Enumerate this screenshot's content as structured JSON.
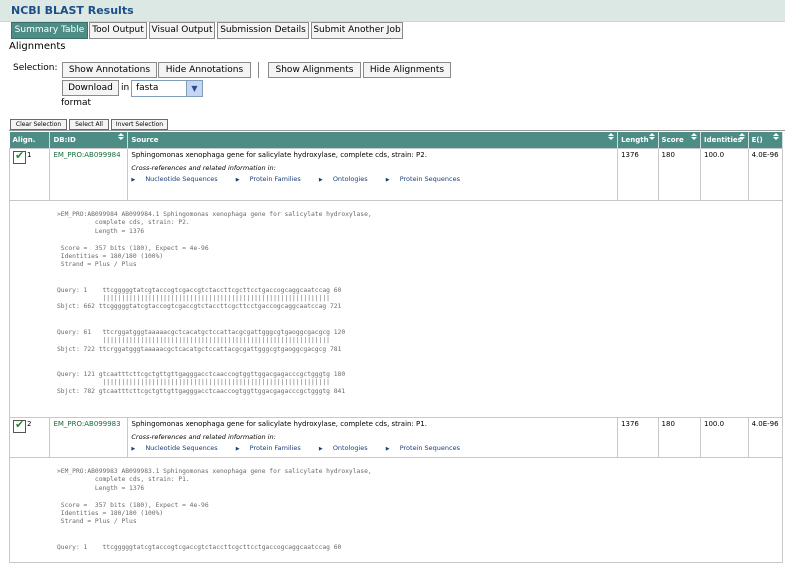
{
  "title": "NCBI BLAST Results",
  "tabs": [
    {
      "label": "Summary Table",
      "active": true
    },
    {
      "label": "Tool Output",
      "active": false
    },
    {
      "label": "Visual Output",
      "active": false
    },
    {
      "label": "Submission Details",
      "active": false
    },
    {
      "label": "Submit Another Job",
      "active": false
    }
  ],
  "section_heading": "Alignments",
  "selection": {
    "label": "Selection:",
    "show_annotations": "Show Annotations",
    "hide_annotations": "Hide Annotations",
    "show_alignments": "Show Alignments",
    "hide_alignments": "Hide Alignments",
    "download": "Download",
    "in_label": "in",
    "format_value": "fasta",
    "format_label": "format"
  },
  "small_buttons": {
    "clear": "Clear Selection",
    "select_all": "Select All",
    "invert": "Invert Selection"
  },
  "columns": [
    "Align.",
    "DB:ID",
    "Source",
    "Length",
    "Score",
    "Identities",
    "E()"
  ],
  "xref_label": "Cross-references and related information in:",
  "xref_links": [
    "Nucleotide Sequences",
    "Protein Families",
    "Ontologies",
    "Protein Sequences"
  ],
  "rows": [
    {
      "num": "1",
      "id": "EM_PRO:AB099984",
      "source": "Sphingomonas xenophaga gene for salicylate hydroxylase, complete cds, strain: P2.",
      "length": "1376",
      "score": "180",
      "identities": "100.0",
      "evalue": "4.0E-96",
      "alignment": ">EM_PRO:AB099984 AB099984.1 Sphingomonas xenophaga gene for salicylate hydroxylase,\n          complete cds, strain: P2.\n          Length = 1376\n\n Score =  357 bits (180), Expect = 4e-96\n Identities = 180/180 (100%)\n Strand = Plus / Plus\n\n\nQuery: 1    ttcgggggtatcgtaccogtcgaccgtctaccttcgcttcctgaccogcaggcaatccag 60\n            ||||||||||||||||||||||||||||||||||||||||||||||||||||||||||||\nSbjct: 662 ttcgggggtatcgtaccogtcgaccgtctaccttcgcttcctgaccogcaggcaatccag 721\n\n\nQuery: 61   ttcrggatgggtaaaaacgctcacatgctccattacgcgattgggcgtgaoggcgacgcg 120\n            ||||||||||||||||||||||||||||||||||||||||||||||||||||||||||||\nSbjct: 722 ttcrggatgggtaaaaacgctcacatgctccattacgcgattgggcgtgaoggcgacgcg 781\n\n\nQuery: 121 gtcaatttcttcgctgttgttgagggacctcaaccogtggttggacgagacccgctgggtg 180\n            ||||||||||||||||||||||||||||||||||||||||||||||||||||||||||||\nSbjct: 782 gtcaatttcttcgctgttgttgagggacctcaaccogtggttggacgagacccgctgggtg 841"
    },
    {
      "num": "2",
      "id": "EM_PRO:AB099983",
      "source": "Sphingomonas xenophaga gene for salicylate hydroxylase, complete cds, strain: P1.",
      "length": "1376",
      "score": "180",
      "identities": "100.0",
      "evalue": "4.0E-96",
      "alignment": ">EM_PRO:AB099983 AB099983.1 Sphingomonas xenophaga gene for salicylate hydroxylase,\n          complete cds, strain: P1.\n          Length = 1376\n\n Score =  357 bits (180), Expect = 4e-96\n Identities = 180/180 (100%)\n Strand = Plus / Plus\n\n\nQuery: 1    ttcgggggtatcgtaccogtcgaccgtctaccttcgcttcctgaccogcaggcaatccag 60"
    }
  ]
}
